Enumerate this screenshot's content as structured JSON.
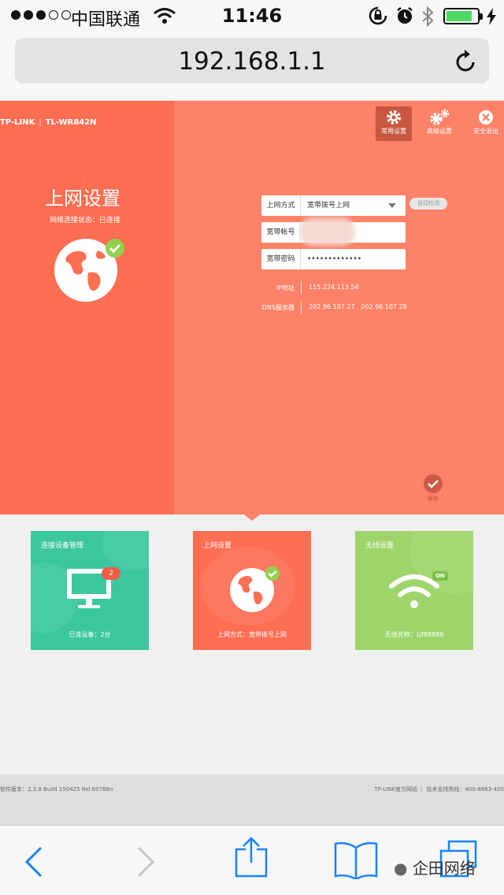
{
  "status_bar": {
    "carrier": "中国联通",
    "time": "11:46",
    "battery_percent": 85,
    "signal_bars": 3
  },
  "browser": {
    "url": "192.168.1.1"
  },
  "router": {
    "brand": "TP-LINK",
    "model": "TL-WR842N",
    "nav": [
      {
        "label": "常用设置",
        "icon": "gear-icon"
      },
      {
        "label": "高级设置",
        "icon": "gears-icon"
      },
      {
        "label": "安全退出",
        "icon": "close-circle-icon"
      }
    ],
    "page_title": "上网设置",
    "connection_status": "网络连接状态：已连接",
    "form": {
      "mode_label": "上网方式",
      "mode_value": "宽带拨号上网",
      "auto_detect": "自动检测",
      "account_label": "宽带帐号",
      "password_label": "宽带密码",
      "password_value": "•••••••••••••"
    },
    "info": {
      "ip_label": "IP地址",
      "ip_value": "115.224.113.54",
      "dns_label": "DNS服务器",
      "dns_value": "202.96.107.27 , 202.96.107.28"
    },
    "save_label": "保存",
    "cards": [
      {
        "title": "连接设备管理",
        "footer": "已连设备：2台",
        "badge": "2",
        "color": "#3cc79f"
      },
      {
        "title": "上网设置",
        "footer": "上网方式：宽带拨号上网",
        "color": "#fe6e53"
      },
      {
        "title": "无线设置",
        "footer": "无线名称：zjf88888",
        "badge": "ON",
        "color": "#9ed56b"
      }
    ],
    "footer": {
      "version": "软件版本：2.3.8 Build 150425 Rel.60768n",
      "links": "TP-LINK官方网站 ｜ 技术支持热线：400-8863-400"
    }
  },
  "watermark": {
    "text": "企田网络"
  },
  "colors": {
    "primary": "#fe8268",
    "primary_dark": "#fe6e53",
    "check_green": "#8fd14f",
    "ios_blue": "#1a82fb"
  }
}
